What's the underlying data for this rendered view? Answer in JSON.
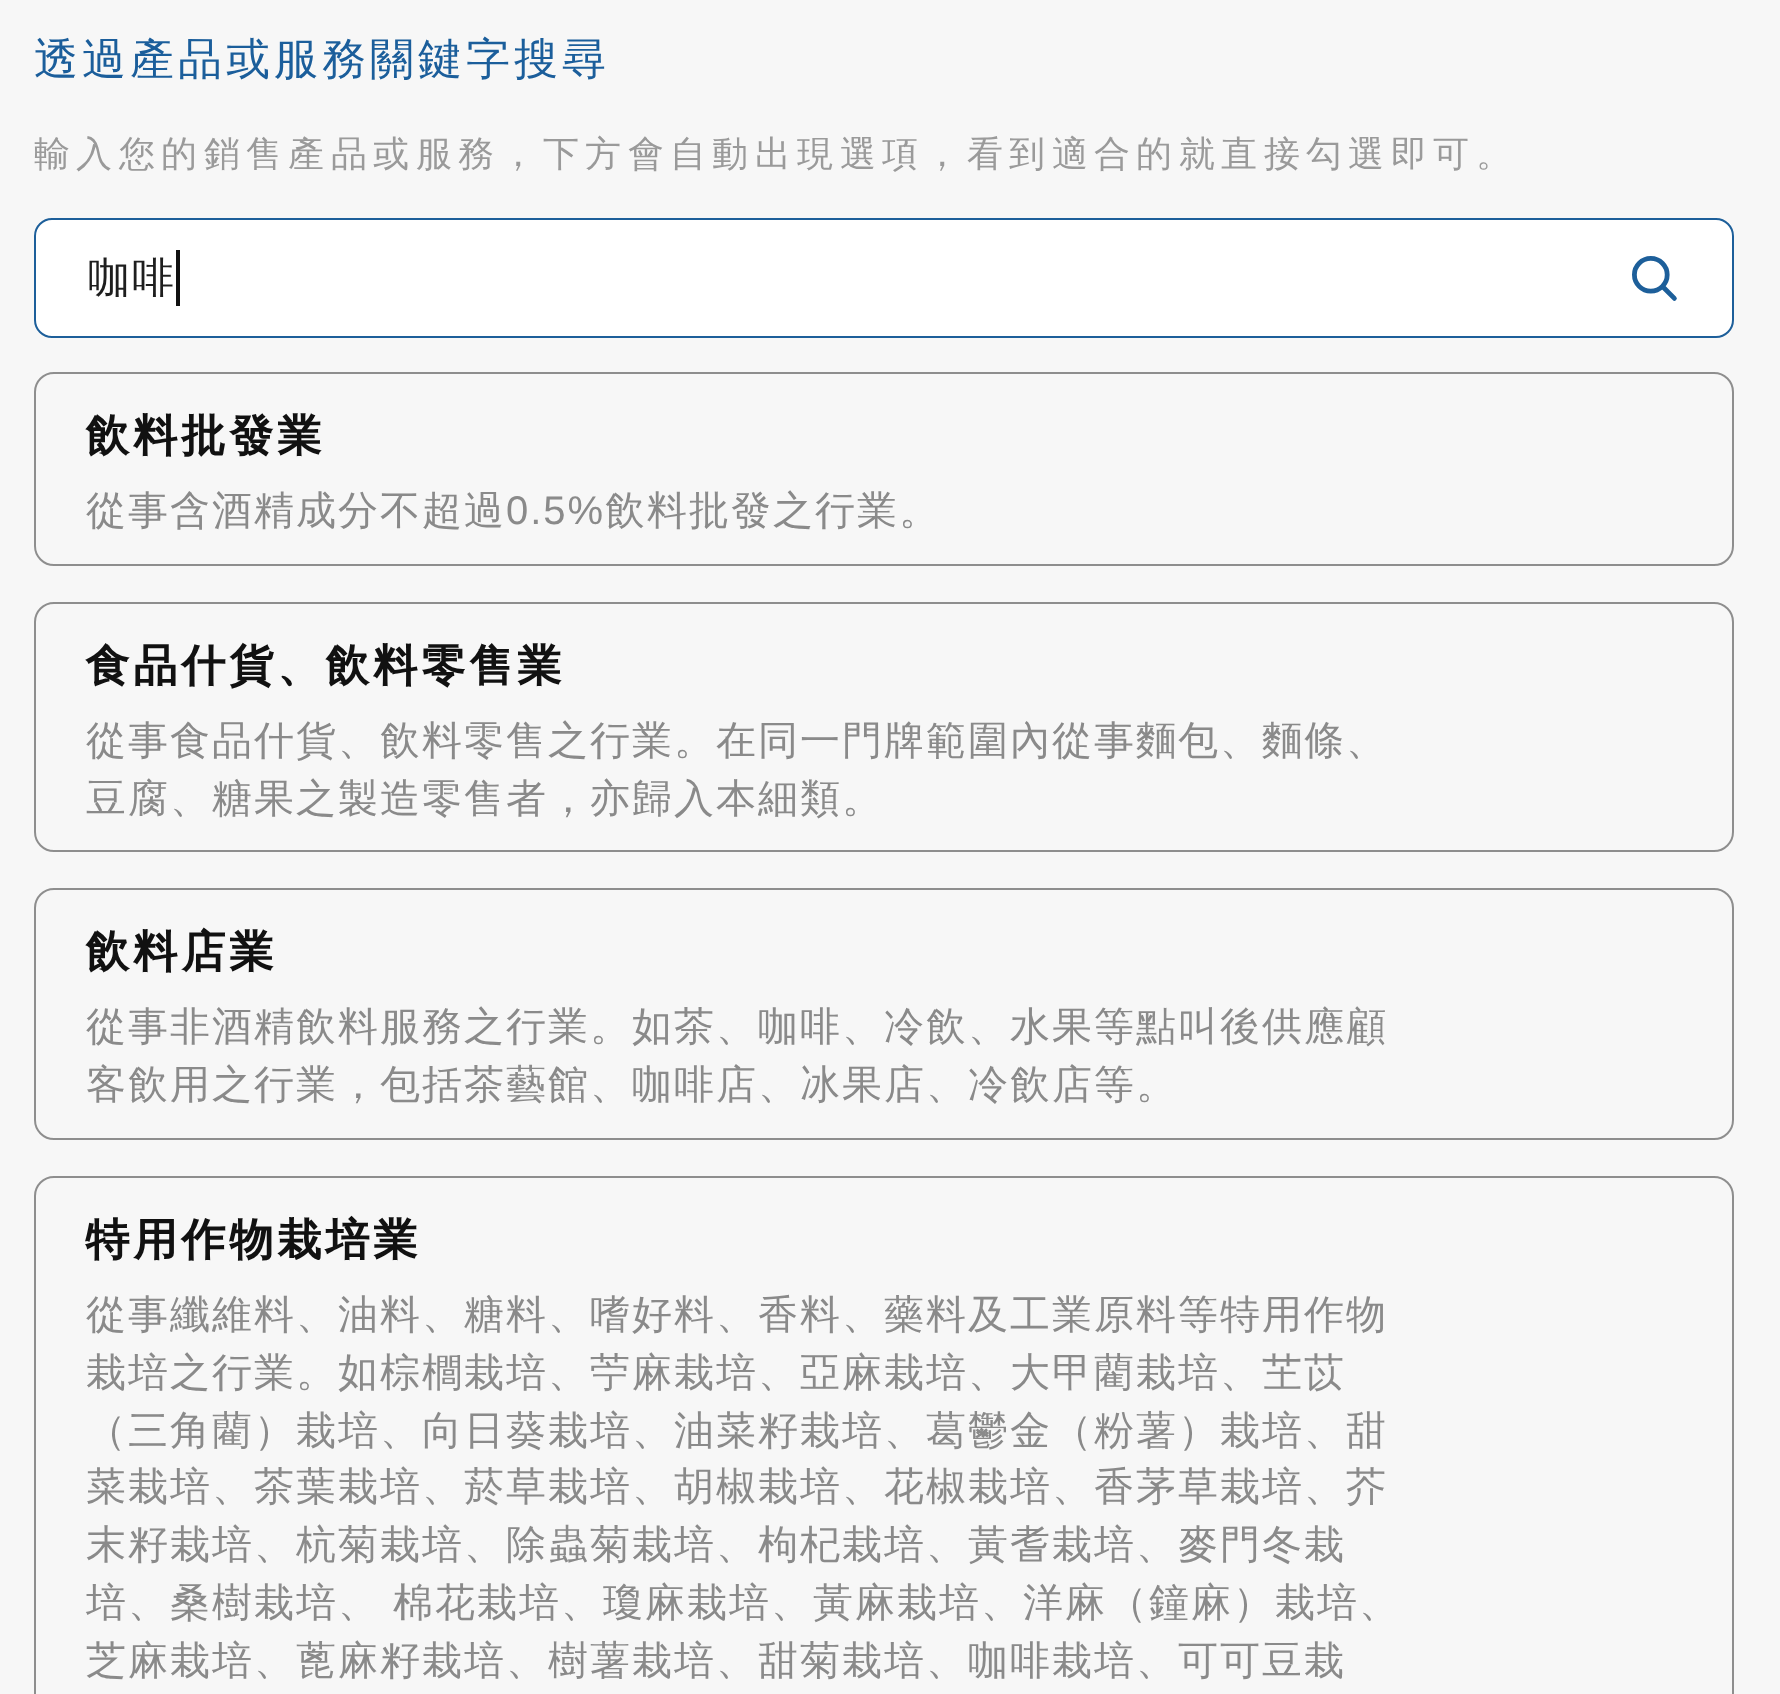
{
  "header": {
    "title": "透過產品或服務關鍵字搜尋",
    "subtitle": "輸入您的銷售產品或服務，下方會自動出現選項，看到適合的就直接勾選即可。"
  },
  "search": {
    "value": "咖啡",
    "focused": true
  },
  "results": [
    {
      "title": "飲料批發業",
      "description": "從事含酒精成分不超過0.5%飲料批發之行業。",
      "selected": false
    },
    {
      "title": "食品什貨、飲料零售業",
      "description": "從事食品什貨、飲料零售之行業。在同一門牌範圍內從事麵包、麵條、豆腐、糖果之製造零售者，亦歸入本細類。",
      "selected": false
    },
    {
      "title": "飲料店業",
      "description": "從事非酒精飲料服務之行業。如茶、咖啡、冷飲、水果等點叫後供應顧客飲用之行業，包括茶藝館、咖啡店、冰果店、冷飲店等。",
      "selected": false
    },
    {
      "title": "特用作物栽培業",
      "description": "從事纖維料、油料、糖料、嗜好料、香料、藥料及工業原料等特用作物栽培之行業。如棕櫚栽培、苧麻栽培、亞麻栽培、大甲藺栽培、芏苡（三角藺）栽培、向日葵栽培、油菜籽栽培、葛鬱金（粉薯）栽培、甜菜栽培、茶葉栽培、菸草栽培、胡椒栽培、花椒栽培、香茅草栽培、芥末籽栽培、杭菊栽培、除蟲菊栽培、枸杞栽培、黃耆栽培、麥門冬栽培、桑樹栽培、 棉花栽培、瓊麻栽培、黃麻栽培、洋麻（鐘麻）栽培、芝麻栽培、蓖麻籽栽培、樹薯栽培、甜菊栽培、咖啡栽培、可可豆栽",
      "selected": false
    }
  ]
}
